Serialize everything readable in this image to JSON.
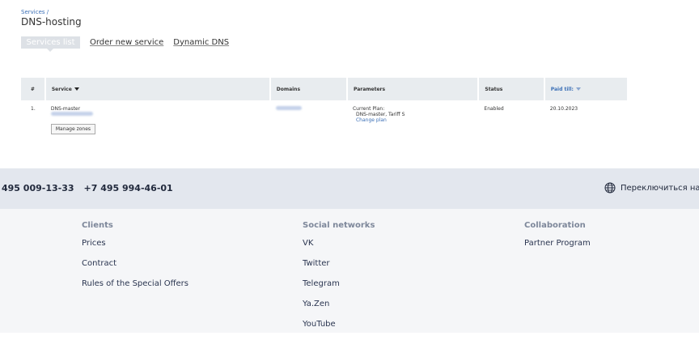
{
  "breadcrumb": {
    "services": "Services",
    "sep": "/"
  },
  "page_title": "DNS-hosting",
  "tabs": [
    {
      "label": "Services list",
      "active": true
    },
    {
      "label": "Order new service"
    },
    {
      "label": "Dynamic DNS"
    }
  ],
  "table": {
    "headers": {
      "num": "#",
      "service": "Service",
      "domains": "Domains",
      "parameters": "Parameters",
      "status": "Status",
      "paid": "Paid till:"
    },
    "rows": [
      {
        "num": "1.",
        "service": "DNS-master",
        "manage": "Manage zones",
        "param_label": "Current Plan:",
        "param_value": "DNS-master, Tariff S",
        "change": "Change plan",
        "status": "Enabled",
        "paid": "20.10.2023"
      }
    ]
  },
  "contacts": {
    "phone1": "495 009-13-33",
    "phone2": "+7 495 994-46-01",
    "lang": "Переключиться на ру"
  },
  "footer": {
    "clients": {
      "title": "Clients",
      "links": [
        "Prices",
        "Contract",
        "Rules of the Special Offers"
      ]
    },
    "social": {
      "title": "Social networks",
      "links": [
        "VK",
        "Twitter",
        "Telegram",
        "Ya.Zen",
        "YouTube"
      ]
    },
    "collab": {
      "title": "Collaboration",
      "links": [
        "Partner Program"
      ]
    }
  },
  "colors": {
    "link": "#3b6fb6",
    "header_bg": "#e8ecef",
    "bar_bg": "#e3e7ee",
    "footer_bg": "#f5f6f8"
  },
  "icons": {
    "sort": "caret-down-icon",
    "lang": "globe-icon"
  }
}
